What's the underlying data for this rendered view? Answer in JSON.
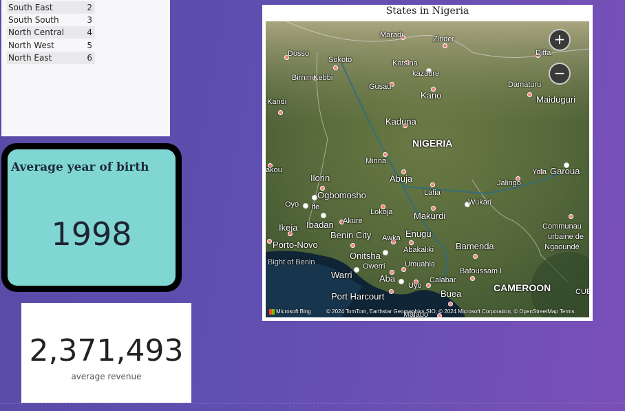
{
  "region_table": {
    "rows": [
      {
        "region": "South East",
        "code": "2"
      },
      {
        "region": "South South",
        "code": "3"
      },
      {
        "region": "North Central",
        "code": "4"
      },
      {
        "region": "North West",
        "code": "5"
      },
      {
        "region": "North East",
        "code": "6"
      }
    ]
  },
  "kpi_birth": {
    "title": "Average year of birth",
    "value": "1998"
  },
  "kpi_revenue": {
    "value": "2,371,493",
    "label": "average revenue"
  },
  "map": {
    "title": "States in Nigeria",
    "zoom_in": "+",
    "zoom_out": "−",
    "attribution": "© 2024 TomTom, Earthstar Geographics SIO, © 2024 Microsoft Corporation, © OpenStreetMap  Terms",
    "provider": "Microsoft Bing",
    "places": {
      "maradi": "Maradi",
      "zinder": "Zinder",
      "dosso": "Dosso",
      "sokoto": "Sokoto",
      "katsina": "Katsina",
      "diffa": "Diffa",
      "birnin_kebbi": "Birnin Kebbi",
      "kazaure": "kazaure",
      "gusau": "Gusau",
      "kano": "Kano",
      "damaturu": "Damaturu",
      "maiduguri": "Maiduguri",
      "kandi": "Kandi",
      "kaduna": "Kaduna",
      "nigeria": "NIGERIA",
      "minna": "Minna",
      "yola": "Yola",
      "garoua": "Garoua",
      "akou": "akou",
      "ilorin": "Ilorin",
      "abuja": "Abuja",
      "jalingo": "Jalingo",
      "ogbomosho": "Ogbomosho",
      "lafia": "Lafia",
      "oyo": "Oyo",
      "ife": "Ife",
      "wukari": "Wukari",
      "lokoja": "Lokoja",
      "makurdi": "Makurdi",
      "ibadan": "Ibadan",
      "akure": "Akure",
      "ikeja": "Ikeja",
      "communaute": "Communau",
      "urbaine": "urbaine de",
      "ngaoundere": "Ngaoundé",
      "porto_novo": "Porto-Novo",
      "benin_city": "Benin City",
      "awka": "Awka",
      "enugu": "Enugu",
      "abakaliki": "Abakaliki",
      "bamenda": "Bamenda",
      "onitsha": "Onitsha",
      "bight": "Bight of Benin",
      "owerri": "Owerri",
      "umuahia": "Umuahia",
      "warri": "Warri",
      "bafoussam": "Bafoussam I",
      "aba": "Aba",
      "calabar": "Calabar",
      "cameroon": "CAMEROON",
      "uyo": "Uyo",
      "port_harcourt": "Port Harcourt",
      "buea": "Buea",
      "malabo": "Malabo",
      "cue": "CUE"
    }
  },
  "colors": {
    "teal_card": "#7fd6d3",
    "background_start": "#5a4aa6",
    "background_end": "#7a50b8"
  }
}
